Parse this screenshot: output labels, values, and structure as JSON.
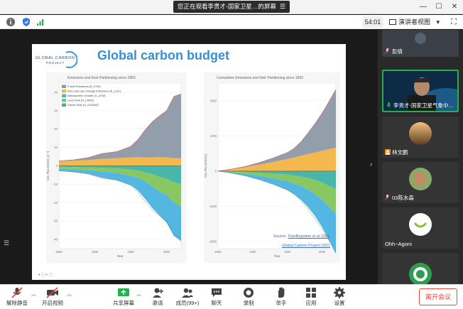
{
  "window": {
    "sharing_banner": "您正在观看李贵才-国家卫星…的屏幕",
    "banner_menu": "☰",
    "minimize": "—",
    "maximize": "☐",
    "close": "✕"
  },
  "toolbar": {
    "timer": "54:01",
    "speaker_view": "演讲者视图",
    "speaker_view_caret": "▾",
    "fullscreen": "⛶"
  },
  "slide": {
    "logo_line1": "GLOBAL CARBON",
    "logo_line2": "PROJECT",
    "title": "Global carbon budget",
    "left_panel_title": "Emissions and their Partitioning since 1850",
    "right_panel_title": "Cumulative Emissions and their Partitioning since 1850",
    "source_label": "Source:",
    "source_link": "Friedlingstein et al 2021",
    "gcp_link": "Global Carbon Project 2021"
  },
  "chart_data": [
    {
      "type": "area",
      "title": "Emissions and their Partitioning since 1850",
      "xlabel": "Year",
      "ylabel": "CO₂ Flux (GtCO₂ yr⁻¹)",
      "xlim": [
        1850,
        2020
      ],
      "ylim": [
        -45,
        45
      ],
      "xticks": [
        1850,
        1900,
        1950,
        2000
      ],
      "yticks": [
        -40,
        -30,
        -20,
        -10,
        0,
        10,
        20,
        30,
        40
      ],
      "legend_position": "top-left",
      "series": [
        {
          "name": "Fossil Emissions (E_FOS)",
          "color": "#8c99a6",
          "sign": "source"
        },
        {
          "name": "Net Land-use Change Emissions (E_LUC)",
          "color": "#f2b545",
          "sign": "source"
        },
        {
          "name": "Atmospheric Growth (G_ATM)",
          "color": "#4bb3e0",
          "sign": "sink"
        },
        {
          "name": "Land Sink (S_LAND)",
          "color": "#83c45a",
          "sign": "sink"
        },
        {
          "name": "Ocean Sink (S_OCEAN)",
          "color": "#3fb2a6",
          "sign": "sink"
        }
      ],
      "x": [
        1850,
        1870,
        1890,
        1910,
        1930,
        1950,
        1960,
        1970,
        1980,
        1990,
        2000,
        2010,
        2020
      ],
      "fossil": [
        0.2,
        0.5,
        1.2,
        2.9,
        3.5,
        6.0,
        9.5,
        15.0,
        19.5,
        22.5,
        25.5,
        33.5,
        35.0
      ],
      "luc": [
        2.5,
        2.8,
        3.2,
        3.8,
        4.2,
        4.6,
        4.8,
        4.6,
        4.5,
        4.7,
        4.6,
        4.2,
        4.1
      ],
      "atm": [
        -1.0,
        -1.5,
        -2.0,
        -3.5,
        -4.0,
        -5.0,
        -7.0,
        -9.5,
        -12.0,
        -13.0,
        -15.0,
        -18.0,
        -19.0
      ],
      "land": [
        -1.2,
        -1.3,
        -1.5,
        -2.0,
        -2.5,
        -3.5,
        -4.0,
        -5.0,
        -6.5,
        -8.0,
        -9.0,
        -11.0,
        -12.0
      ],
      "ocean": [
        -0.5,
        -0.6,
        -0.8,
        -1.0,
        -1.3,
        -2.0,
        -2.5,
        -3.5,
        -4.5,
        -6.0,
        -7.0,
        -9.0,
        -10.0
      ]
    },
    {
      "type": "area",
      "title": "Cumulative Emissions and their Partitioning since 1850",
      "xlabel": "Year",
      "ylabel": "CO₂ Flux (GtCO₂)",
      "xlim": [
        1850,
        2020
      ],
      "ylim": [
        -2200,
        2500
      ],
      "xticks": [
        1850,
        1900,
        1950,
        2000
      ],
      "yticks": [
        -2000,
        -1000,
        0,
        1000,
        2000
      ],
      "x": [
        1850,
        1870,
        1890,
        1910,
        1930,
        1950,
        1960,
        1970,
        1980,
        1990,
        2000,
        2010,
        2020
      ],
      "fossil": [
        0,
        6,
        20,
        60,
        115,
        180,
        260,
        400,
        600,
        820,
        1060,
        1350,
        1650
      ],
      "luc": [
        0,
        55,
        115,
        185,
        260,
        345,
        390,
        440,
        485,
        530,
        580,
        625,
        670
      ],
      "atm": [
        0,
        -25,
        -60,
        -110,
        -175,
        -250,
        -310,
        -395,
        -500,
        -630,
        -780,
        -950,
        -1140
      ],
      "land": [
        0,
        -25,
        -55,
        -90,
        -135,
        -190,
        -230,
        -275,
        -330,
        -400,
        -490,
        -590,
        -700
      ],
      "ocean": [
        0,
        -10,
        -25,
        -45,
        -70,
        -100,
        -125,
        -155,
        -195,
        -250,
        -320,
        -420,
        -510
      ]
    }
  ],
  "sidebar": {
    "participants": [
      {
        "name": "彭倩",
        "type": "photo-tile"
      },
      {
        "name": "李贵才-国家卫星气象中…",
        "type": "speaker",
        "active": true
      },
      {
        "name": "林文鹏",
        "type": "photo-tile"
      },
      {
        "name": "03陈水森",
        "type": "photo-tile"
      },
      {
        "name": "Ohh~Agoni",
        "type": "avatar"
      },
      {
        "name": "",
        "type": "avatar"
      }
    ]
  },
  "controls": {
    "mute": "解除静音",
    "video": "开启视频",
    "share": "共享屏幕",
    "invite": "邀请",
    "members": "成员(99+)",
    "chat": "聊天",
    "record": "录制",
    "raise_hand": "举手",
    "apps": "应用",
    "settings": "设置",
    "leave": "离开会议"
  },
  "colors": {
    "accent_green": "#23b14d",
    "leave_red": "#e04a3f",
    "title_blue": "#3a8fd0",
    "mute_red": "#e0453a"
  }
}
